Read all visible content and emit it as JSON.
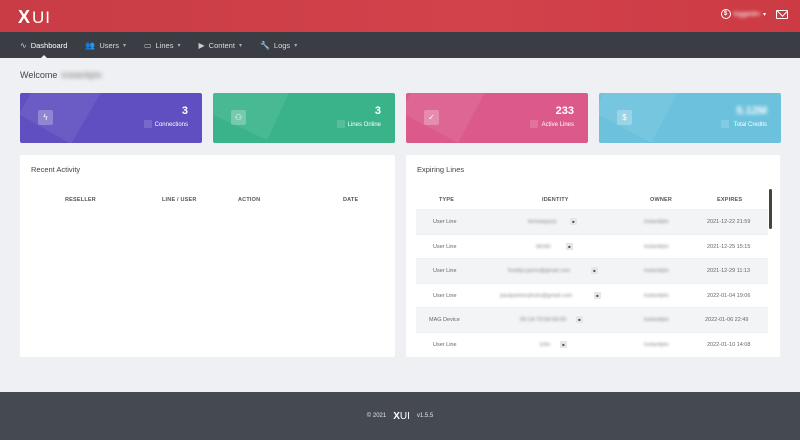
{
  "header": {
    "logo_x": "X",
    "logo_ui": "UI",
    "user_name": "loggedin",
    "colors": {
      "header": "#cc3b44",
      "nav": "#3a3d43"
    }
  },
  "nav": [
    {
      "label": "Dashboard",
      "icon": "pulse-icon"
    },
    {
      "label": "Users",
      "icon": "users-icon"
    },
    {
      "label": "Lines",
      "icon": "monitor-icon"
    },
    {
      "label": "Content",
      "icon": "play-icon"
    },
    {
      "label": "Logs",
      "icon": "wrench-icon"
    }
  ],
  "welcome": {
    "label": "Welcome",
    "name": "instantiptv"
  },
  "stats": [
    {
      "value": "3",
      "label": "Connections",
      "icon": "bolt-icon",
      "color": "#5f4fc1"
    },
    {
      "value": "3",
      "label": "Lines Online",
      "icon": "users-icon",
      "color": "#3ab38a"
    },
    {
      "value": "233",
      "label": "Active Lines",
      "icon": "check-circle-icon",
      "color": "#dc5a8b"
    },
    {
      "value": "5.12M",
      "label": "Total Credits",
      "icon": "dollar-icon",
      "color": "#6cc2dd"
    }
  ],
  "recent_activity": {
    "title": "Recent Activity",
    "columns": [
      "RESELLER",
      "LINE / USER",
      "ACTION",
      "DATE"
    ]
  },
  "expiring_lines": {
    "title": "Expiring Lines",
    "columns": [
      "TYPE",
      "IDENTITY",
      "OWNER",
      "EXPIRES"
    ],
    "rows": [
      {
        "type": "User Line",
        "identity": "kirmaaypzq",
        "owner": "instantiptv",
        "expires": "2021-12-22 21:59"
      },
      {
        "type": "User Line",
        "identity": "dimitri",
        "owner": "instantiptv",
        "expires": "2021-12-25 15:15"
      },
      {
        "type": "User Line",
        "identity": "freddycypres@gmail.com",
        "owner": "instantiptv",
        "expires": "2021-12-29 11:13"
      },
      {
        "type": "User Line",
        "identity": "paulpartnerphoto@gmail.com",
        "owner": "instantiptv",
        "expires": "2022-01-04 19:06"
      },
      {
        "type": "MAG Device",
        "identity": "00:1A:79:5A:58:0D",
        "owner": "instantiptv",
        "expires": "2022-01-06 22:49"
      },
      {
        "type": "User Line",
        "identity": "k3m",
        "owner": "instantiptv",
        "expires": "2022-01-10 14:08"
      }
    ]
  },
  "footer": {
    "copyright": "© 2021",
    "logo_x": "X",
    "logo_ui": "UI",
    "version": "v1.5.5"
  }
}
